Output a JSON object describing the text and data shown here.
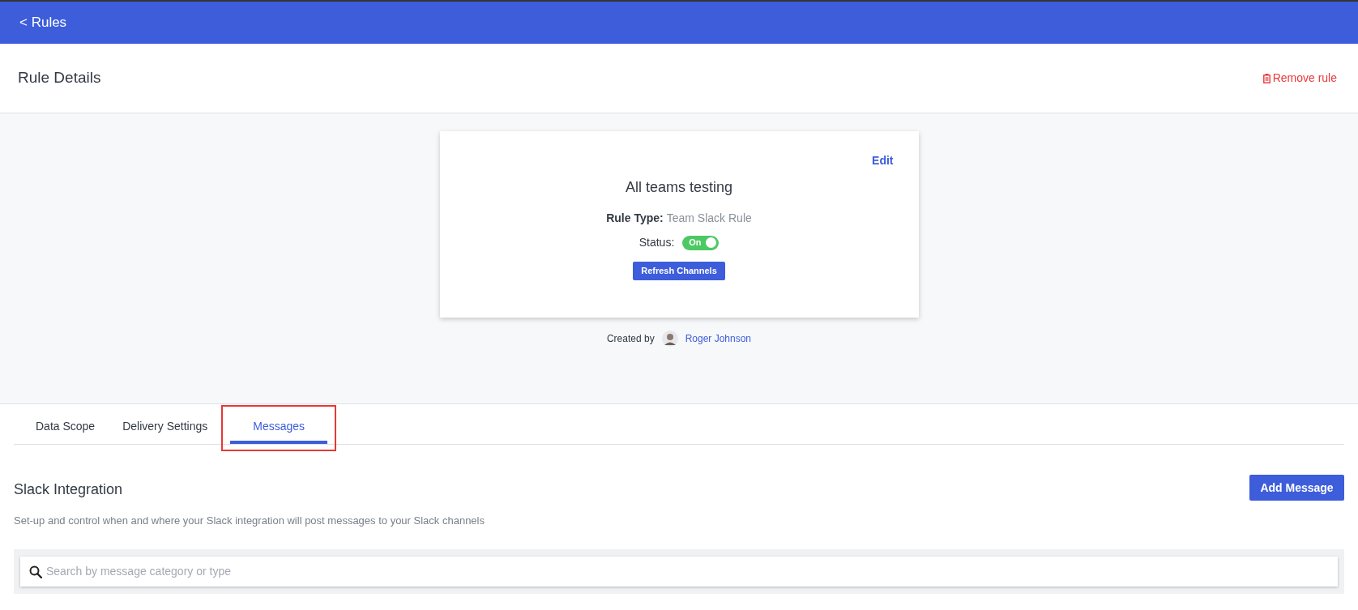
{
  "top_bar": {
    "back_link": "< Rules"
  },
  "header": {
    "title": "Rule Details",
    "remove_button": "Remove rule"
  },
  "rule_card": {
    "edit_link": "Edit",
    "name": "All teams testing",
    "rule_type_label": "Rule Type:",
    "rule_type_value": "Team Slack Rule",
    "status_label": "Status:",
    "status_toggle": {
      "label": "On",
      "on": true
    },
    "refresh_button": "Refresh Channels"
  },
  "created_by": {
    "label": "Created by",
    "author": "Roger Johnson"
  },
  "tabs": [
    {
      "label": "Data Scope",
      "selected": false,
      "highlighted": false
    },
    {
      "label": "Delivery Settings",
      "selected": false,
      "highlighted": false
    },
    {
      "label": "Messages",
      "selected": true,
      "highlighted": true
    }
  ],
  "section": {
    "title": "Slack Integration",
    "description": "Set-up and control when and where your Slack integration will post messages to your Slack channels",
    "add_button": "Add Message",
    "search": {
      "placeholder": "Search by message category or type"
    }
  }
}
